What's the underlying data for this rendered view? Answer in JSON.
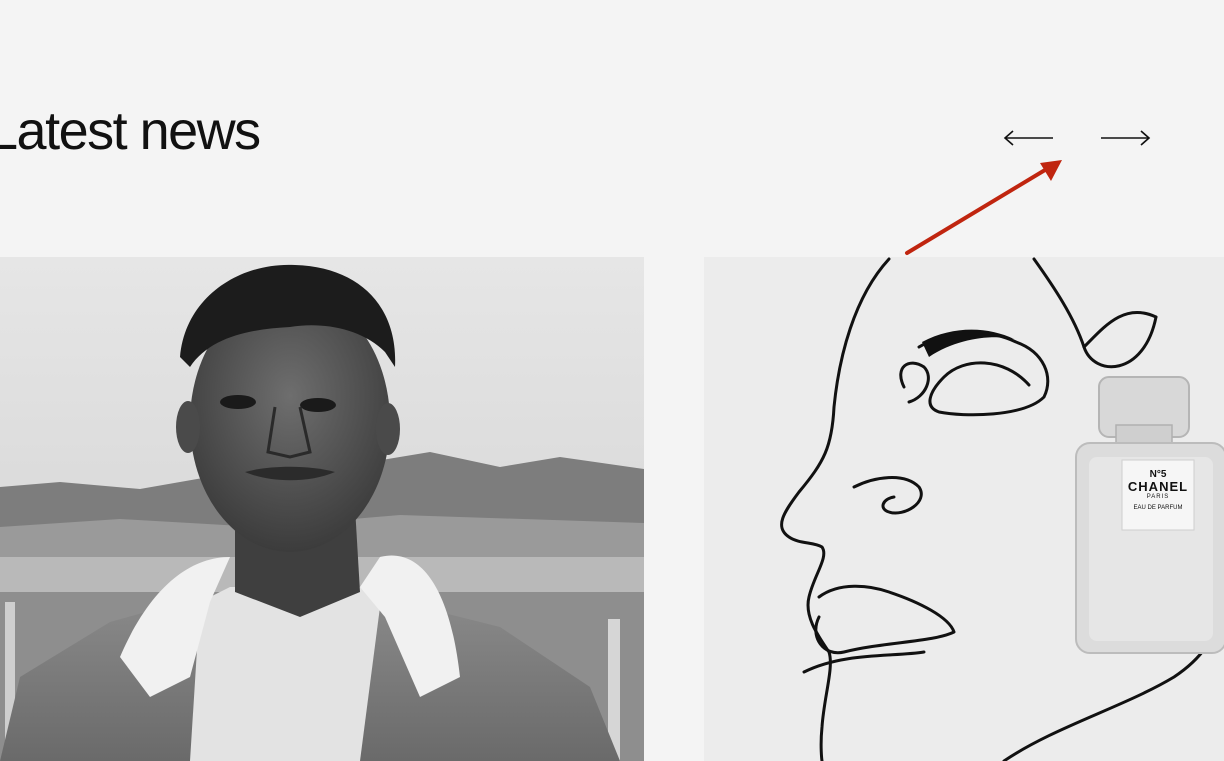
{
  "section": {
    "title": "Latest news"
  },
  "carousel": {
    "prev_icon": "arrow-left-icon",
    "next_icon": "arrow-right-icon"
  },
  "annotation": {
    "color": "#c0250f"
  },
  "cards": [
    {
      "image": "portrait-photo-image",
      "bottle_text": {
        "line1": "",
        "line2": "",
        "line3": "",
        "line4": ""
      }
    },
    {
      "image": "line-art-face-perfume-image",
      "bottle_text": {
        "line1": "N°5",
        "line2": "CHANEL",
        "line3": "PARIS",
        "line4": "EAU DE PARFUM"
      }
    }
  ]
}
